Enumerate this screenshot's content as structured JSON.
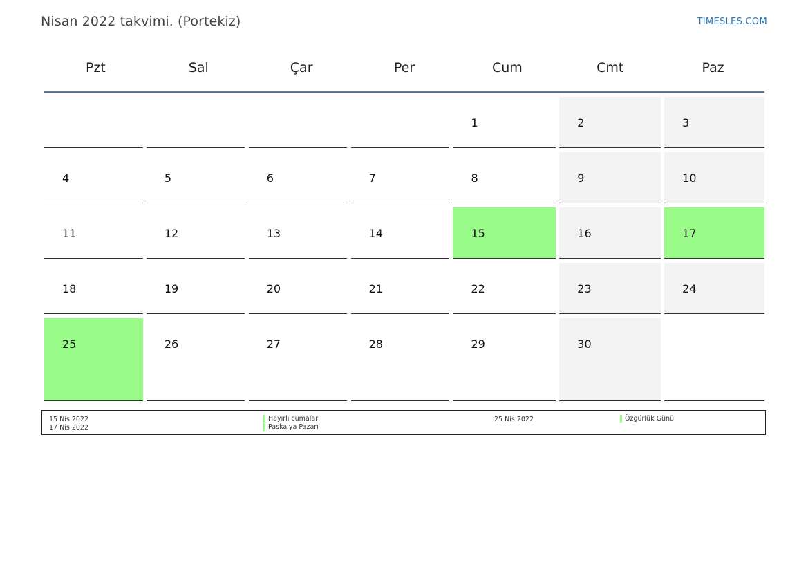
{
  "header": {
    "title": "Nisan 2022 takvimi. (Portekiz)",
    "brand": "TIMESLES.COM"
  },
  "colors": {
    "holiday": "#99fb88",
    "weekend": "#f3f3f3",
    "header_rule": "#5a7696",
    "brand": "#2a79b8"
  },
  "weekdays": [
    "Pzt",
    "Sal",
    "Çar",
    "Per",
    "Cum",
    "Cmt",
    "Paz"
  ],
  "weeks": [
    [
      "",
      "",
      "",
      "",
      "1",
      "2",
      "3"
    ],
    [
      "4",
      "5",
      "6",
      "7",
      "8",
      "9",
      "10"
    ],
    [
      "11",
      "12",
      "13",
      "14",
      "15",
      "16",
      "17"
    ],
    [
      "18",
      "19",
      "20",
      "21",
      "22",
      "23",
      "24"
    ],
    [
      "25",
      "26",
      "27",
      "28",
      "29",
      "30",
      ""
    ]
  ],
  "holidays": [
    {
      "date": "15 Nis 2022",
      "name": "Hayırlı cumalar"
    },
    {
      "date": "17 Nis 2022",
      "name": "Paskalya Pazarı"
    },
    {
      "date": "25 Nis 2022",
      "name": "Özgürlük Günü"
    }
  ]
}
